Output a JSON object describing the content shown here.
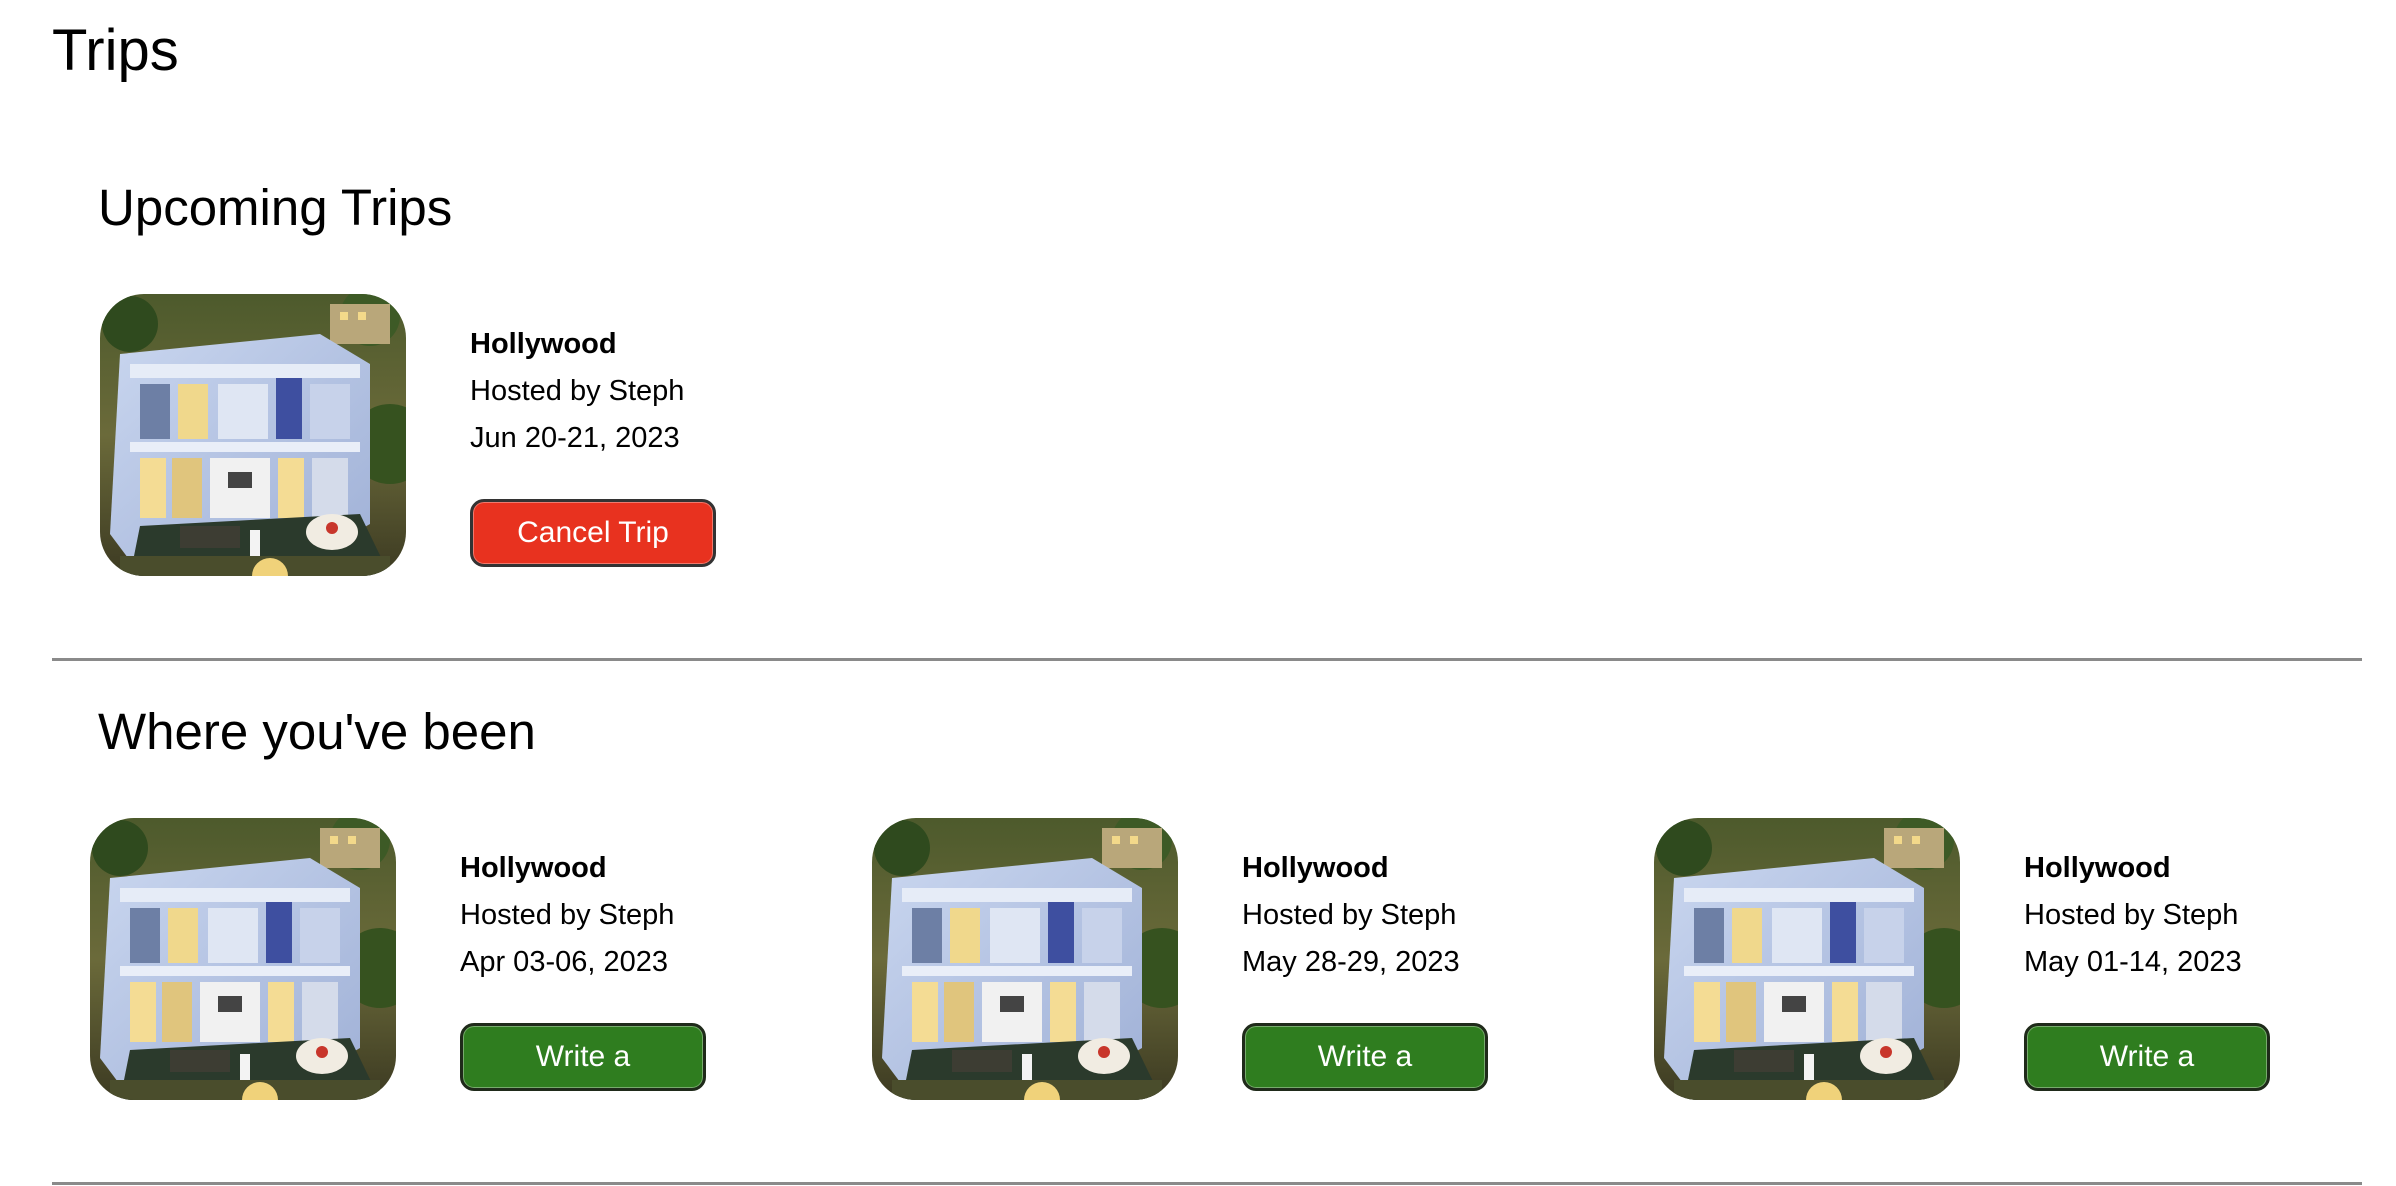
{
  "page": {
    "title": "Trips"
  },
  "upcoming": {
    "heading": "Upcoming Trips",
    "trips": [
      {
        "name": "Hollywood",
        "host": "Hosted by Steph",
        "dates": "Jun 20-21, 2023",
        "action": "Cancel Trip"
      }
    ]
  },
  "past": {
    "heading": "Where you've been",
    "trips": [
      {
        "name": "Hollywood",
        "host": "Hosted by Steph",
        "dates": "Apr 03-06, 2023",
        "action": "Write a Review"
      },
      {
        "name": "Hollywood",
        "host": "Hosted by Steph",
        "dates": "May 28-29, 2023",
        "action": "Write a Review"
      },
      {
        "name": "Hollywood",
        "host": "Hosted by Steph",
        "dates": "May 01-14, 2023",
        "action": "Write a Review"
      }
    ]
  },
  "colors": {
    "cancel": "#e8321f",
    "review": "#2f7d1f",
    "divider": "#8a8a8a"
  }
}
